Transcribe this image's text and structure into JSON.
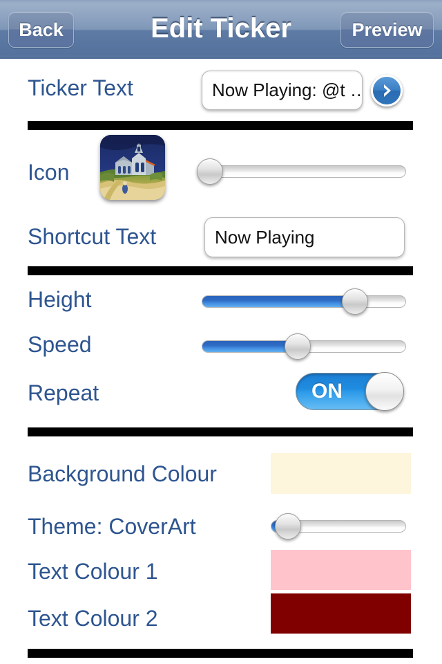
{
  "navbar": {
    "back_label": "Back",
    "title": "Edit Ticker",
    "preview_label": "Preview"
  },
  "rows": {
    "ticker_text": {
      "label": "Ticker Text",
      "value": "Now Playing: @t …",
      "arrow_icon": "chevron-right-icon"
    },
    "icon": {
      "label": "Icon",
      "thumbnail": "church-at-auvers-painting",
      "slider_value": 4
    },
    "shortcut_text": {
      "label": "Shortcut Text",
      "value": "Now Playing"
    },
    "height": {
      "label": "Height",
      "slider_value": 75
    },
    "speed": {
      "label": "Speed",
      "slider_value": 47
    },
    "repeat": {
      "label": "Repeat",
      "toggle_state": "ON"
    },
    "background_colour": {
      "label": "Background Colour",
      "colour": "#FDF5DC"
    },
    "theme": {
      "label": "Theme: CoverArt",
      "slider_value": 13
    },
    "text_colour_1": {
      "label": "Text Colour 1",
      "colour": "#FFC3CC"
    },
    "text_colour_2": {
      "label": "Text Colour 2",
      "colour": "#800000"
    }
  },
  "theme_colours": {
    "label_blue": "#2E5590",
    "navbar_blue": "#5D7BA4",
    "slider_fill_blue": "#2F6CC4",
    "toggle_blue": "#1F8CE0",
    "divider_black": "#000000"
  }
}
